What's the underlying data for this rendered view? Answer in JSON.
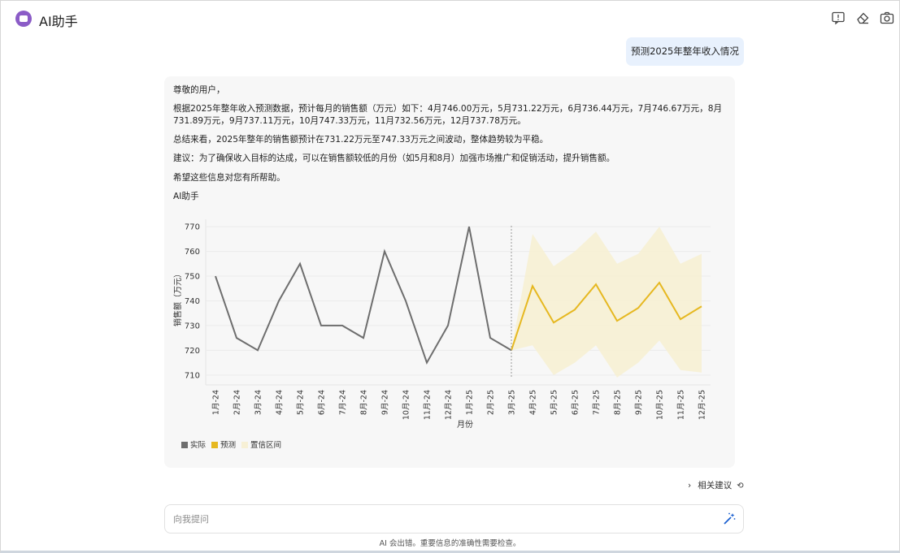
{
  "app": {
    "title": "AI助手"
  },
  "header": {
    "icons": [
      "feedback-icon",
      "eraser-icon",
      "camera-icon"
    ]
  },
  "user_message": "预测2025年整年收入情况",
  "answer": {
    "greeting": "尊敬的用户，",
    "paragraph1": "根据2025年整年收入预测数据，预计每月的销售额（万元）如下：4月746.00万元，5月731.22万元，6月736.44万元，7月746.67万元，8月731.89万元，9月737.11万元，10月747.33万元，11月732.56万元，12月737.78万元。",
    "paragraph2": "总结来看，2025年整年的销售额预计在731.22万元至747.33万元之间波动，整体趋势较为平稳。",
    "paragraph3": "建议：为了确保收入目标的达成，可以在销售额较低的月份（如5月和8月）加强市场推广和促销活动，提升销售额。",
    "paragraph4": "希望这些信息对您有所帮助。",
    "signature": "AI助手"
  },
  "chart_data": {
    "type": "line",
    "title": "",
    "xlabel": "月份",
    "ylabel": "销售额（万元）",
    "ylim": [
      706,
      773
    ],
    "yticks": [
      710,
      720,
      730,
      740,
      750,
      760,
      770
    ],
    "grid": true,
    "legend_placement": "bottom-left",
    "categories": [
      "1月-24",
      "2月-24",
      "3月-24",
      "4月-24",
      "5月-24",
      "6月-24",
      "7月-24",
      "8月-24",
      "9月-24",
      "10月-24",
      "11月-24",
      "12月-24",
      "1月-25",
      "2月-25",
      "3月-25",
      "4月-25",
      "5月-25",
      "6月-25",
      "7月-25",
      "8月-25",
      "9月-25",
      "10月-25",
      "11月-25",
      "12月-25"
    ],
    "series": [
      {
        "name": "实际",
        "color": "#6e6e6e",
        "values": [
          750,
          725,
          720,
          740,
          755,
          730,
          730,
          725,
          760,
          740,
          715,
          730,
          770,
          725,
          720,
          null,
          null,
          null,
          null,
          null,
          null,
          null,
          null,
          null
        ]
      },
      {
        "name": "预测",
        "color": "#e6b820",
        "values": [
          null,
          null,
          null,
          null,
          null,
          null,
          null,
          null,
          null,
          null,
          null,
          null,
          null,
          null,
          720,
          746.0,
          731.22,
          736.44,
          746.67,
          731.89,
          737.11,
          747.33,
          732.56,
          737.78
        ]
      },
      {
        "name": "置信区间",
        "color": "#f7f0d5",
        "lower": [
          null,
          null,
          null,
          null,
          null,
          null,
          null,
          null,
          null,
          null,
          null,
          null,
          null,
          null,
          720,
          722,
          710,
          715,
          722,
          709,
          715,
          724,
          712,
          711
        ],
        "upper": [
          null,
          null,
          null,
          null,
          null,
          null,
          null,
          null,
          null,
          null,
          null,
          null,
          null,
          null,
          720,
          767,
          754,
          760,
          768,
          755,
          759,
          770,
          755,
          759
        ]
      }
    ],
    "forecast_start": "3月-25"
  },
  "suggestions_label": "相关建议",
  "composer": {
    "placeholder": "向我提问"
  },
  "footnote": "AI 会出错。重要信息的准确性需要检查。"
}
